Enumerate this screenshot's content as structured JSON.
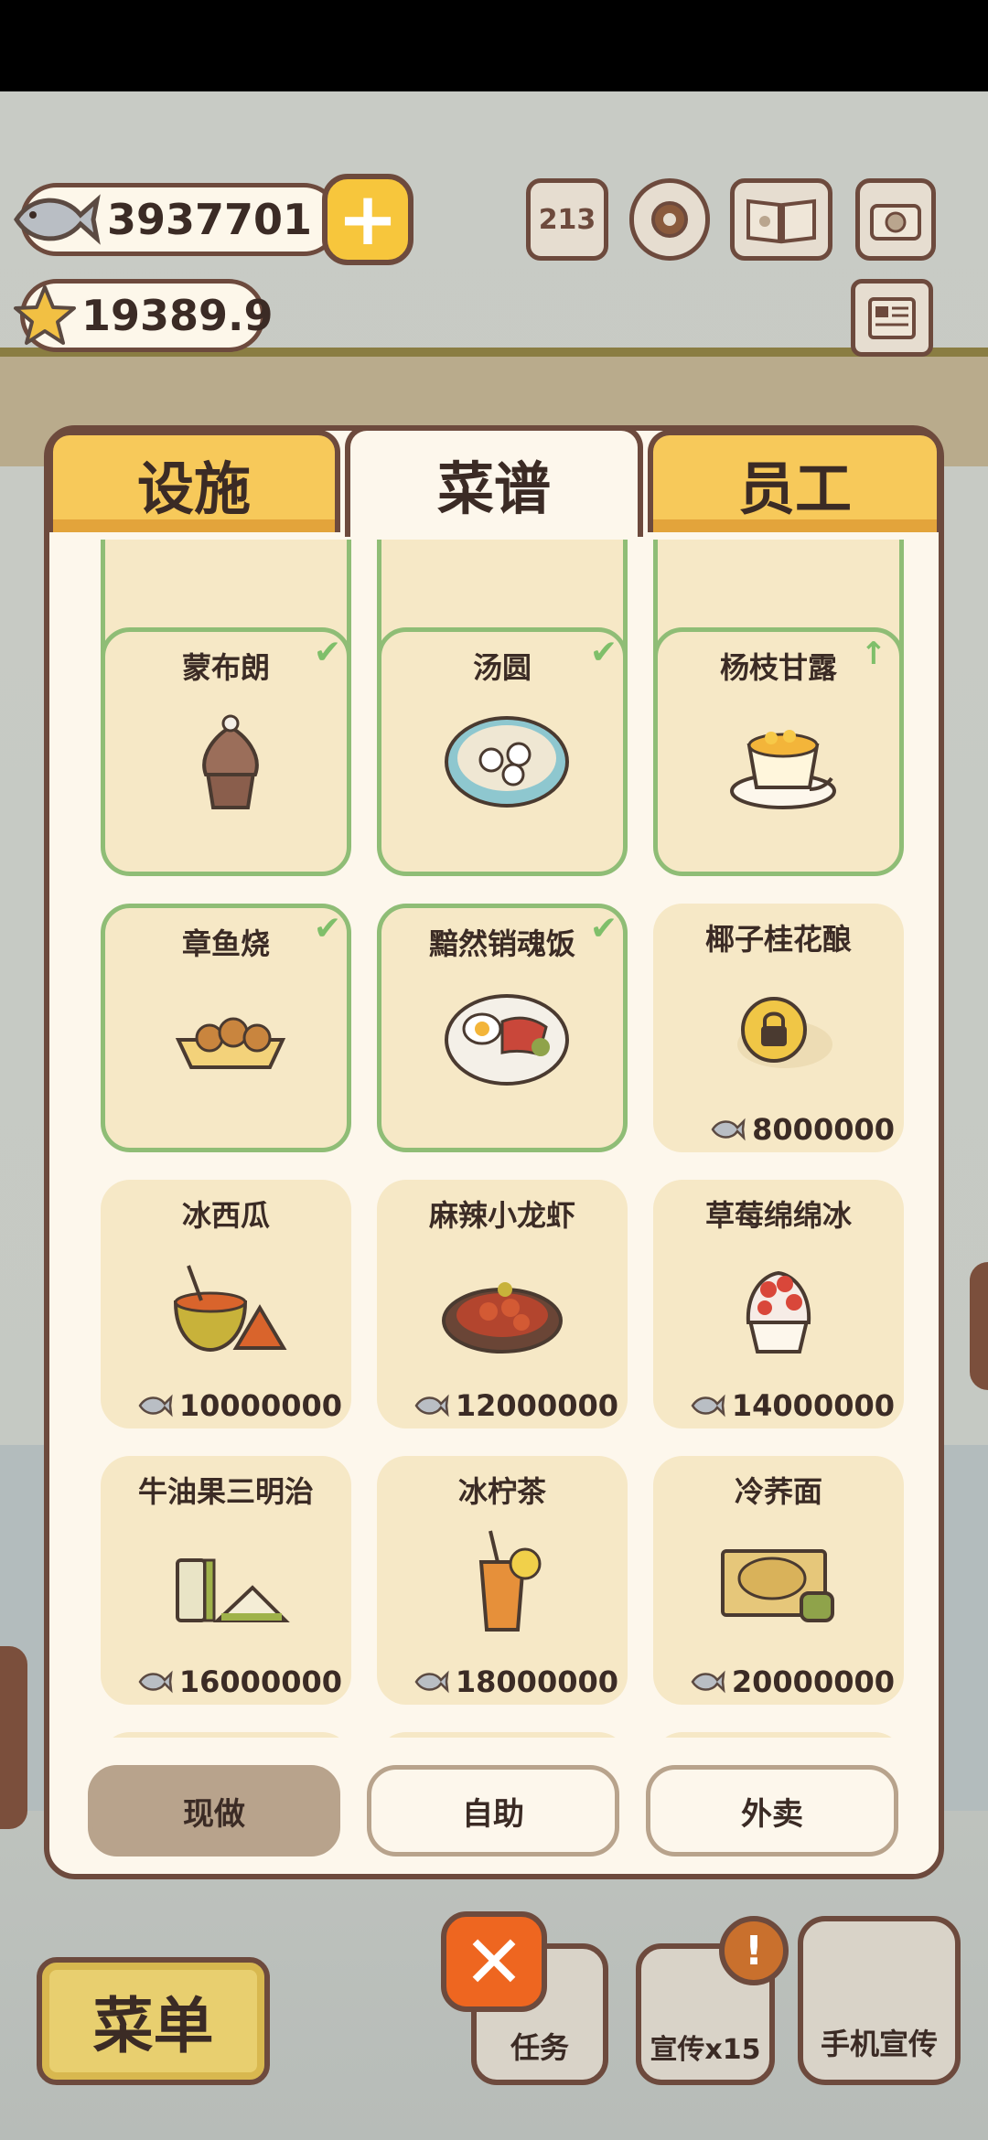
{
  "hud": {
    "fish_amount": "3937701",
    "star_amount": "19389.9",
    "rank_icon_text": "213"
  },
  "tabs": [
    {
      "label": "设施",
      "active": false
    },
    {
      "label": "菜谱",
      "active": true
    },
    {
      "label": "员工",
      "active": false
    }
  ],
  "recipes": [
    {
      "name": "蒙布朗",
      "status": "owned",
      "badge": "check",
      "icon": "mont-blanc-icon"
    },
    {
      "name": "汤圆",
      "status": "owned",
      "badge": "check",
      "icon": "tangyuan-icon"
    },
    {
      "name": "杨枝甘露",
      "status": "owned",
      "badge": "upgrade-arrow",
      "icon": "mango-sago-icon"
    },
    {
      "name": "章鱼烧",
      "status": "owned",
      "badge": "check",
      "icon": "takoyaki-icon"
    },
    {
      "name": "黯然销魂饭",
      "status": "owned",
      "badge": "check",
      "icon": "char-siu-rice-icon"
    },
    {
      "name": "椰子桂花酿",
      "status": "locked",
      "price": "8000000",
      "icon": "lock-icon"
    },
    {
      "name": "冰西瓜",
      "status": "buyable",
      "price": "10000000",
      "icon": "watermelon-icon"
    },
    {
      "name": "麻辣小龙虾",
      "status": "buyable",
      "price": "12000000",
      "icon": "crayfish-icon"
    },
    {
      "name": "草莓绵绵冰",
      "status": "buyable",
      "price": "14000000",
      "icon": "strawberry-ice-icon"
    },
    {
      "name": "牛油果三明治",
      "status": "buyable",
      "price": "16000000",
      "icon": "sandwich-icon"
    },
    {
      "name": "冰柠茶",
      "status": "buyable",
      "price": "18000000",
      "icon": "lemon-tea-icon"
    },
    {
      "name": "冷荞面",
      "status": "buyable",
      "price": "20000000",
      "icon": "soba-icon"
    }
  ],
  "sub_tabs": [
    {
      "label": "现做",
      "active": true
    },
    {
      "label": "自助",
      "active": false
    },
    {
      "label": "外卖",
      "active": false
    }
  ],
  "bottom_bar": {
    "menu_label": "菜单",
    "task_label": "任务",
    "promo_label": "宣传x15",
    "phone_promo_label": "手机宣传",
    "alert_mark": "!"
  },
  "colors": {
    "owned_border": "#8fbd76",
    "card_bg": "#f6e8c6",
    "tab_yellow": "#f7c95a",
    "outline_brown": "#6d4a3d",
    "close_orange": "#ee6620"
  }
}
